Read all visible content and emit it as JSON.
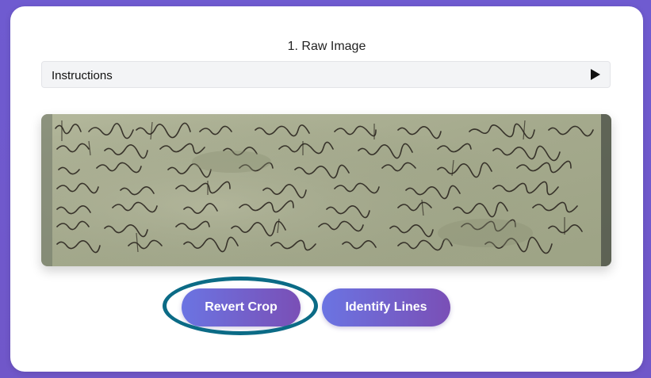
{
  "step": {
    "title": "1. Raw Image"
  },
  "instructions": {
    "label": "Instructions",
    "toggle_icon": "play-triangle-icon"
  },
  "image": {
    "description": "Scanned medieval handwritten manuscript (cropped strip)",
    "paper_color": "#a7ac8f",
    "ink_color": "#2c2620"
  },
  "buttons": {
    "revert_label": "Revert Crop",
    "identify_label": "Identify Lines"
  },
  "colors": {
    "background": "#6f5bd0",
    "button_gradient_start": "#6b74e2",
    "button_gradient_end": "#7a4fb6",
    "highlight_ring": "#0b6b86"
  }
}
